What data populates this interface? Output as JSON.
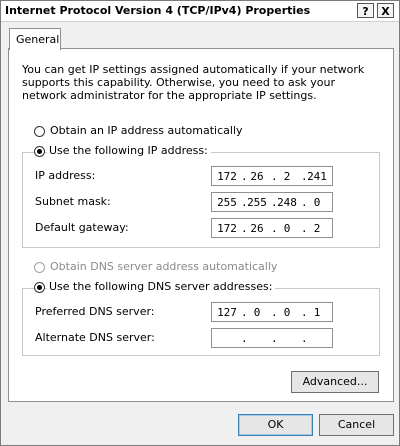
{
  "window": {
    "title": "Internet Protocol Version 4 (TCP/IPv4) Properties",
    "help_button": "?",
    "close_button": "X"
  },
  "tabs": [
    {
      "label": "General",
      "selected": true
    }
  ],
  "intro_text": "You can get IP settings assigned automatically if your network supports this capability. Otherwise, you need to ask your network administrator for the appropriate IP settings.",
  "ip_section": {
    "auto_option": {
      "label": "Obtain an IP address automatically",
      "selected": false
    },
    "manual_option": {
      "label": "Use the following IP address:",
      "selected": true
    },
    "fields": [
      {
        "label": "IP address:",
        "octets": [
          "172",
          "26",
          "2",
          "241"
        ]
      },
      {
        "label": "Subnet mask:",
        "octets": [
          "255",
          "255",
          "248",
          "0"
        ]
      },
      {
        "label": "Default gateway:",
        "octets": [
          "172",
          "26",
          "0",
          "2"
        ]
      }
    ]
  },
  "dns_section": {
    "auto_option": {
      "label": "Obtain DNS server address automatically",
      "selected": false,
      "enabled": false
    },
    "manual_option": {
      "label": "Use the following DNS server addresses:",
      "selected": true
    },
    "fields": [
      {
        "label": "Preferred DNS server:",
        "octets": [
          "127",
          "0",
          "0",
          "1"
        ]
      },
      {
        "label": "Alternate DNS server:",
        "octets": [
          "",
          "",
          "",
          ""
        ]
      }
    ]
  },
  "buttons": {
    "advanced": "Advanced...",
    "ok": "OK",
    "cancel": "Cancel"
  },
  "dot": "."
}
